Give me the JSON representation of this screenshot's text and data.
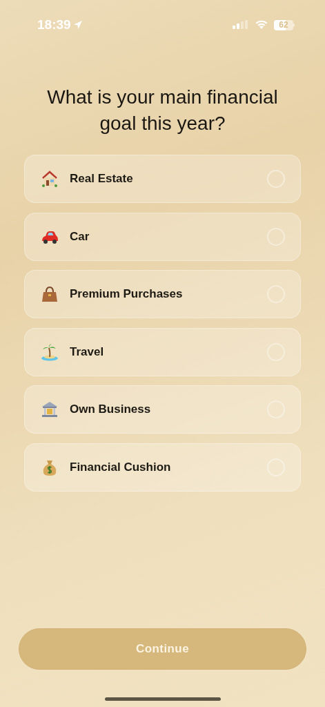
{
  "status_bar": {
    "time": "18:39",
    "battery": "62"
  },
  "title": "What is your main financial goal this year?",
  "options": [
    {
      "label": "Real Estate",
      "selected": false
    },
    {
      "label": "Car",
      "selected": false
    },
    {
      "label": "Premium Purchases",
      "selected": false
    },
    {
      "label": "Travel",
      "selected": false
    },
    {
      "label": "Own Business",
      "selected": false
    },
    {
      "label": "Financial Cushion",
      "selected": false
    }
  ],
  "continue_button": {
    "label": "Continue",
    "disabled": true
  }
}
